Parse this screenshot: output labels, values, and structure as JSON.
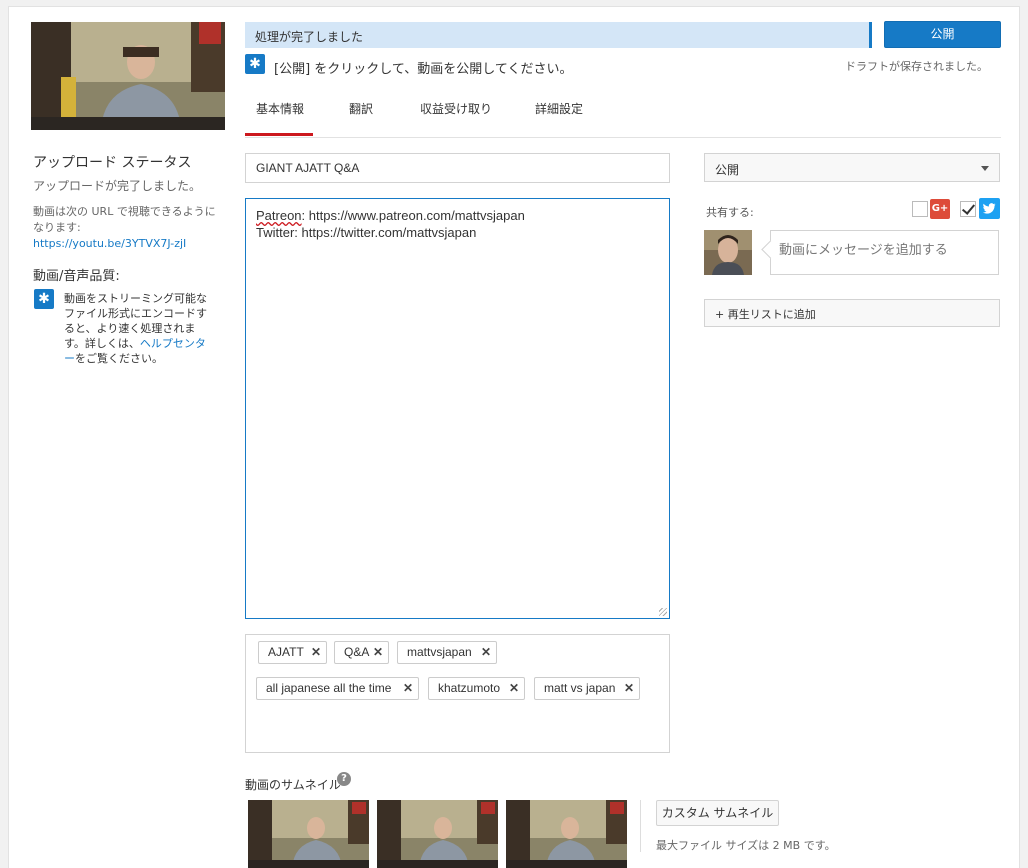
{
  "sidebar": {
    "status_title": "アップロード ステータス",
    "status_done": "アップロードが完了しました。",
    "url_text": "動画は次の URL で視聴できるようになります: ",
    "url_link": "https://youtu.be/3YTVX7J-zjI",
    "quality_title": "動画/音声品質:",
    "quality_text": "動画をストリーミング可能なファイル形式にエンコードすると、より速く処理されます。詳しくは、",
    "quality_link": "ヘルプセンター",
    "quality_tail": "をご覧ください。"
  },
  "topbar": {
    "progress_label": "処理が完了しました",
    "publish_label": "公開",
    "hint": "[公開] をクリックして、動画を公開してください。",
    "draft_saved": "ドラフトが保存されました。"
  },
  "tabs": [
    {
      "label": "基本情報"
    },
    {
      "label": "翻訳"
    },
    {
      "label": "収益受け取り"
    },
    {
      "label": "詳細設定"
    }
  ],
  "form": {
    "title_value": "GIANT AJATT Q&A",
    "description_line1_prefix": "Patreon",
    "description_line1_rest": ": https://www.patreon.com/mattvsjapan",
    "description_line2": "Twitter: https://twitter.com/mattvsjapan",
    "tags": [
      "AJATT",
      "Q&A",
      "mattvsjapan",
      "all japanese all the time",
      "khatzumoto",
      "matt vs japan"
    ]
  },
  "right": {
    "privacy_value": "公開",
    "share_label": "共有する:",
    "gplus_label": "G+",
    "message_placeholder": "動画にメッセージを追加する",
    "playlist_label": "+ 再生リストに追加"
  },
  "thumbnails": {
    "title": "動画のサムネイル",
    "help": "?",
    "custom_button": "カスタム サムネイル",
    "max_size": "最大ファイル サイズは 2 MB です。"
  }
}
